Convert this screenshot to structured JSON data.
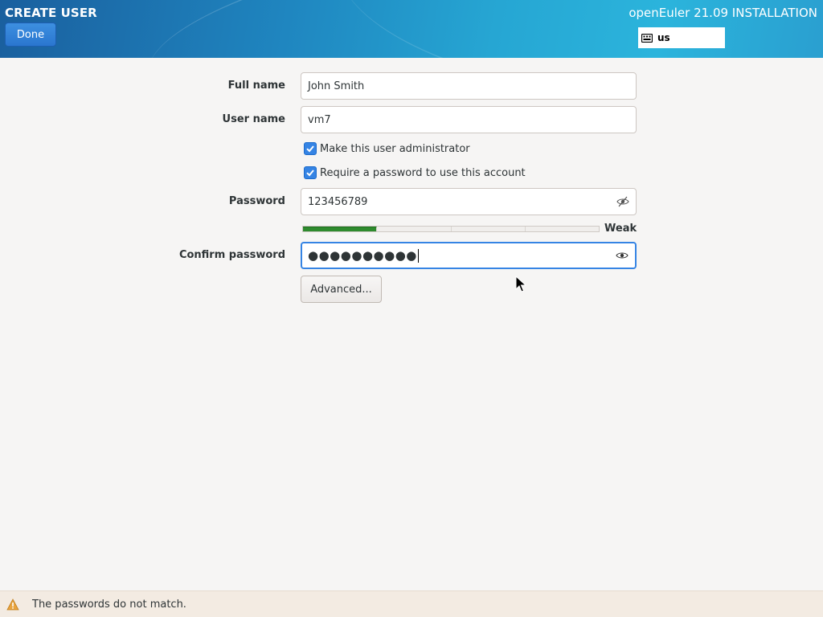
{
  "header": {
    "spoke_title": "CREATE USER",
    "done_label": "Done",
    "install_title": "openEuler 21.09 INSTALLATION",
    "keyboard_layout": "us"
  },
  "form": {
    "full_name": {
      "label": "Full name",
      "value": "John Smith"
    },
    "user_name": {
      "label": "User name",
      "value": "vm7"
    },
    "admin_checkbox": {
      "label": "Make this user administrator",
      "checked": true
    },
    "require_password_checkbox": {
      "label": "Require a password to use this account",
      "checked": true
    },
    "password": {
      "label": "Password",
      "value": "123456789",
      "visible": true
    },
    "strength": {
      "label": "Weak",
      "level_fraction": 0.25,
      "color": "#2e8b2e"
    },
    "confirm_password": {
      "label": "Confirm password",
      "masked_value": "●●●●●●●●●●",
      "visible": false
    },
    "advanced_label": "Advanced..."
  },
  "status": {
    "message": "The passwords do not match.",
    "icon": "warning-icon"
  },
  "colors": {
    "accent": "#3584e4",
    "header_start": "#1a5f9e",
    "header_end": "#2bb4dc",
    "warning": "#e8a33d"
  }
}
